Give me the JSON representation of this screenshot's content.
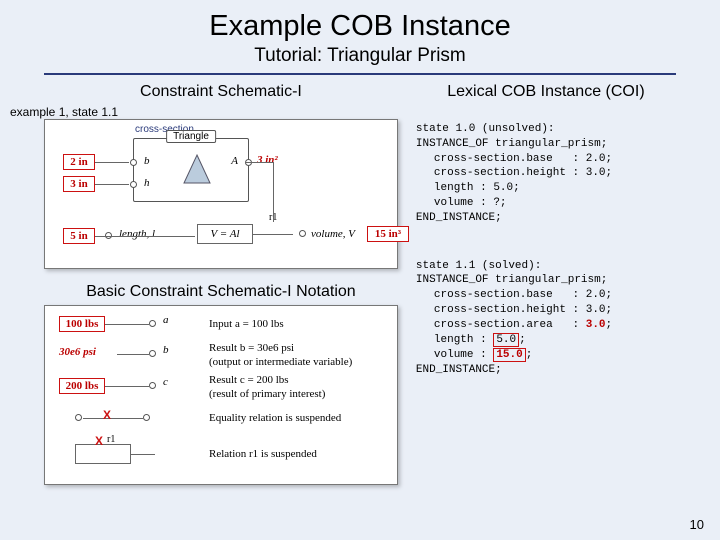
{
  "title": "Example COB Instance",
  "subtitle": "Tutorial: Triangular Prism",
  "left_header": "Constraint Schematic-I",
  "right_header": "Lexical COB Instance (COI)",
  "example_label": "example 1, state 1.1",
  "notation_header": "Basic Constraint Schematic-I Notation",
  "sch": {
    "cs_label": "cross-section",
    "tri_title": "Triangle",
    "in2": "2 in",
    "in3": "3 in",
    "in5": "5 in",
    "b": "b",
    "h": "h",
    "A": "A",
    "area_val": "3 in²",
    "r1": "r1",
    "length_lbl": "length, l",
    "vol_lbl": "volume, V",
    "vol_val": "15 in³",
    "eq_VAl": "V = Al"
  },
  "not": {
    "lbs100": "100 lbs",
    "psi": "30e6 psi",
    "lbs200": "200 lbs",
    "a": "a",
    "b": "b",
    "c": "c",
    "r1": "r1",
    "line_a": "Input a = 100 lbs",
    "line_b": "Result b = 30e6 psi",
    "line_b2": "(output or intermediate variable)",
    "line_c": "Result c = 200 lbs",
    "line_c2": "(result of primary interest)",
    "line_eq": "Equality relation is suspended",
    "line_r1": "Relation r1 is suspended",
    "x": "X"
  },
  "code1": {
    "l0": "state 1.0 (unsolved):",
    "l1": "INSTANCE_OF triangular_prism;",
    "l2": "cross-section.base   : 2.0;",
    "l3": "cross-section.height : 3.0;",
    "l4": "length : 5.0;",
    "l5": "volume : ?;",
    "l6": "END_INSTANCE;"
  },
  "code2": {
    "l0": "state 1.1 (solved):",
    "l1": "INSTANCE_OF triangular_prism;",
    "l2": "cross-section.base   : 2.0;",
    "l3": "cross-section.height : 3.0;",
    "l4a": "cross-section.area   : ",
    "l4b": "3.0",
    "l4c": ";",
    "l5a": "length : ",
    "l5b": "5.0",
    "l5c": ";",
    "l6a": "volume : ",
    "l6b": "15.0",
    "l6c": ";",
    "l7": "END_INSTANCE;"
  },
  "pagenum": "10"
}
